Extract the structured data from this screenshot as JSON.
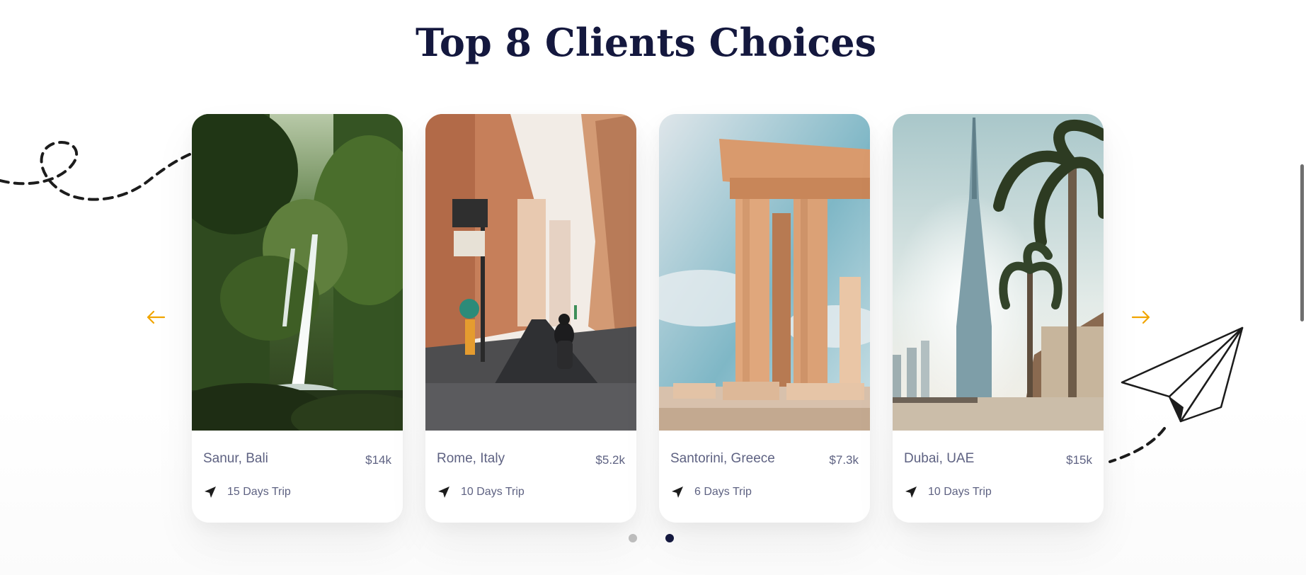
{
  "section": {
    "title": "Top 8 Clients Choices"
  },
  "cards": [
    {
      "name": "Sanur, Bali",
      "price": "$14k",
      "trip": "15 Days Trip",
      "icon": "navigation-arrow-icon"
    },
    {
      "name": "Rome, Italy",
      "price": "$5.2k",
      "trip": "10 Days Trip",
      "icon": "navigation-arrow-icon"
    },
    {
      "name": "Santorini, Greece",
      "price": "$7.3k",
      "trip": "6 Days Trip",
      "icon": "navigation-arrow-icon"
    },
    {
      "name": "Dubai, UAE",
      "price": "$15k",
      "trip": "10 Days Trip",
      "icon": "navigation-arrow-icon"
    }
  ],
  "carousel": {
    "prev_icon": "arrow-left-icon",
    "next_icon": "arrow-right-icon",
    "pages": 2,
    "active_page": 2
  },
  "colors": {
    "title": "#14183e",
    "text": "#5e6282",
    "accent": "#f1a501",
    "dot_active": "#14183e",
    "dot_inactive": "#bcbcbc"
  }
}
